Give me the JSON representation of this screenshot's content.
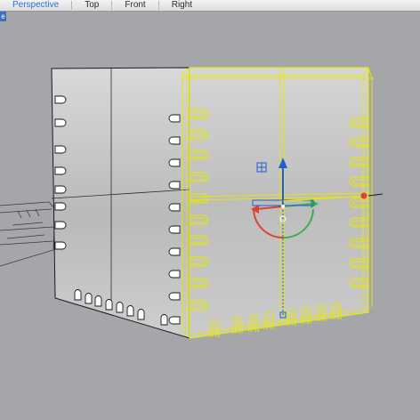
{
  "viewport_tabs": [
    {
      "label": "Perspective",
      "active": true
    },
    {
      "label": "Top",
      "active": false
    },
    {
      "label": "Front",
      "active": false
    },
    {
      "label": "Right",
      "active": false
    }
  ],
  "corner_menu_glyph": "e",
  "colors": {
    "viewport_bg": "#a4a6a9",
    "selection": "#e8e800",
    "gumball_x": "#e0402e",
    "gumball_y": "#3bb04a",
    "gumball_z": "#1d5fd6",
    "active_tab": "#2b6fd6"
  },
  "icons": {
    "corner": "viewport-menu-icon",
    "gumball": "gumball-widget-icon"
  }
}
